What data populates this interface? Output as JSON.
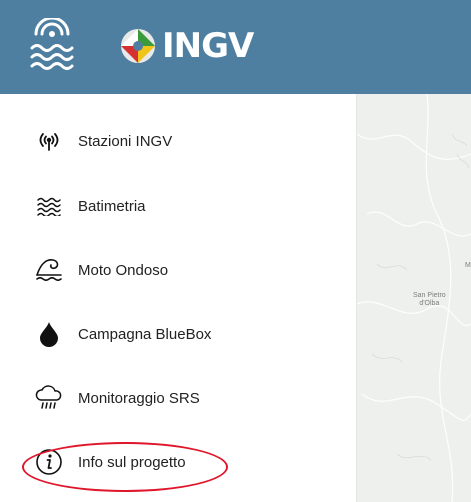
{
  "header": {
    "brand": "INGV",
    "background": "#4e7fa1"
  },
  "sidebar": {
    "items": [
      {
        "label": "Stazioni INGV",
        "icon": "radio-tower-icon"
      },
      {
        "label": "Batimetria",
        "icon": "waves-icon"
      },
      {
        "label": "Moto Ondoso",
        "icon": "ocean-wave-icon"
      },
      {
        "label": "Campagna BlueBox",
        "icon": "water-drop-icon"
      },
      {
        "label": "Monitoraggio SRS",
        "icon": "cloud-rain-icon"
      },
      {
        "label": "Info sul progetto",
        "icon": "info-icon"
      }
    ]
  },
  "map": {
    "place_label_line1": "San Pietro",
    "place_label_line2": "d'Olba",
    "edge_label": "M"
  },
  "highlight_color": "#e0162b"
}
